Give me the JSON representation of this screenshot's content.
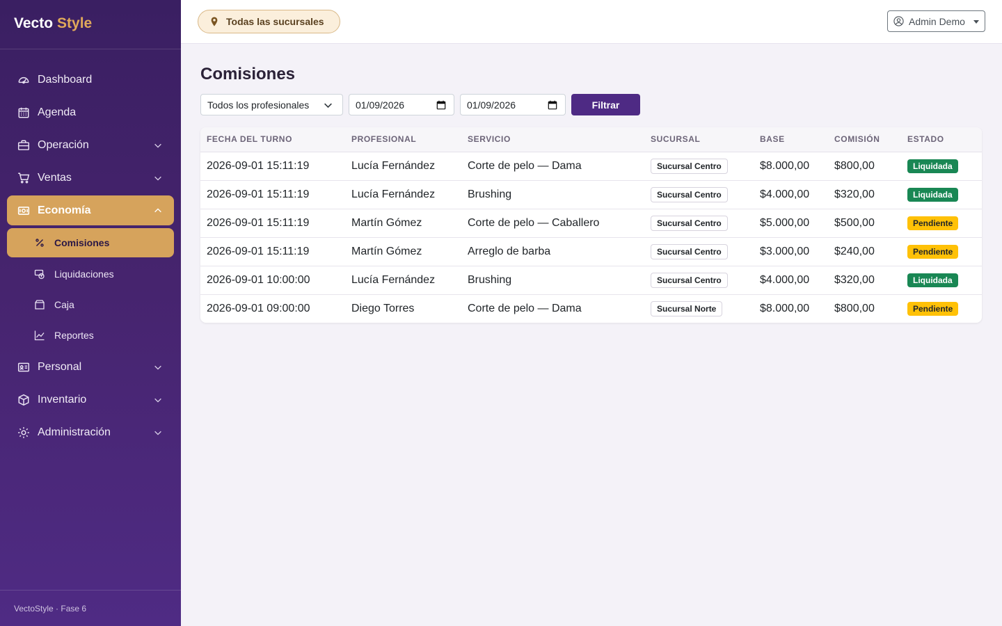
{
  "brand": {
    "part1": "Vecto",
    "part2": "Style"
  },
  "sidebar": {
    "items": [
      {
        "label": "Dashboard",
        "icon": "gauge-icon"
      },
      {
        "label": "Agenda",
        "icon": "calendar-icon"
      },
      {
        "label": "Operación",
        "icon": "briefcase-icon"
      },
      {
        "label": "Ventas",
        "icon": "cart-icon"
      },
      {
        "label": "Economía",
        "icon": "cash-icon"
      },
      {
        "label": "Personal",
        "icon": "id-card-icon"
      },
      {
        "label": "Inventario",
        "icon": "box-icon"
      },
      {
        "label": "Administración",
        "icon": "gear-icon"
      }
    ],
    "economia_sub": [
      {
        "label": "Comisiones",
        "icon": "percent-icon"
      },
      {
        "label": "Liquidaciones",
        "icon": "coins-icon"
      },
      {
        "label": "Caja",
        "icon": "wallet-icon"
      },
      {
        "label": "Reportes",
        "icon": "chart-line-icon"
      }
    ],
    "footer": "VectoStyle · Fase 6"
  },
  "topbar": {
    "branch": "Todas las sucursales",
    "user": "Admin Demo"
  },
  "page": {
    "title": "Comisiones",
    "filters": {
      "professional": "Todos los profesionales",
      "date_from": "01/09/2026",
      "date_to": "01/09/2026",
      "button": "Filtrar"
    }
  },
  "table": {
    "headers": [
      "FECHA DEL TURNO",
      "PROFESIONAL",
      "SERVICIO",
      "SUCURSAL",
      "BASE",
      "COMISIÓN",
      "ESTADO"
    ],
    "rows": [
      {
        "fecha": "2026-09-01 15:11:19",
        "profesional": "Lucía Fernández",
        "servicio": "Corte de pelo — Dama",
        "sucursal": "Sucursal Centro",
        "base": "$8.000,00",
        "comision": "$800,00",
        "estado": "Liquidada"
      },
      {
        "fecha": "2026-09-01 15:11:19",
        "profesional": "Lucía Fernández",
        "servicio": "Brushing",
        "sucursal": "Sucursal Centro",
        "base": "$4.000,00",
        "comision": "$320,00",
        "estado": "Liquidada"
      },
      {
        "fecha": "2026-09-01 15:11:19",
        "profesional": "Martín Gómez",
        "servicio": "Corte de pelo — Caballero",
        "sucursal": "Sucursal Centro",
        "base": "$5.000,00",
        "comision": "$500,00",
        "estado": "Pendiente"
      },
      {
        "fecha": "2026-09-01 15:11:19",
        "profesional": "Martín Gómez",
        "servicio": "Arreglo de barba",
        "sucursal": "Sucursal Centro",
        "base": "$3.000,00",
        "comision": "$240,00",
        "estado": "Pendiente"
      },
      {
        "fecha": "2026-09-01 10:00:00",
        "profesional": "Lucía Fernández",
        "servicio": "Brushing",
        "sucursal": "Sucursal Centro",
        "base": "$4.000,00",
        "comision": "$320,00",
        "estado": "Liquidada"
      },
      {
        "fecha": "2026-09-01 09:00:00",
        "profesional": "Diego Torres",
        "servicio": "Corte de pelo — Dama",
        "sucursal": "Sucursal Norte",
        "base": "$8.000,00",
        "comision": "$800,00",
        "estado": "Pendiente"
      }
    ]
  },
  "colors": {
    "sidebar_bg": "#3a1f62",
    "accent": "#d6a35c",
    "primary": "#4e2a84",
    "success": "#198754",
    "warning": "#ffc107"
  }
}
